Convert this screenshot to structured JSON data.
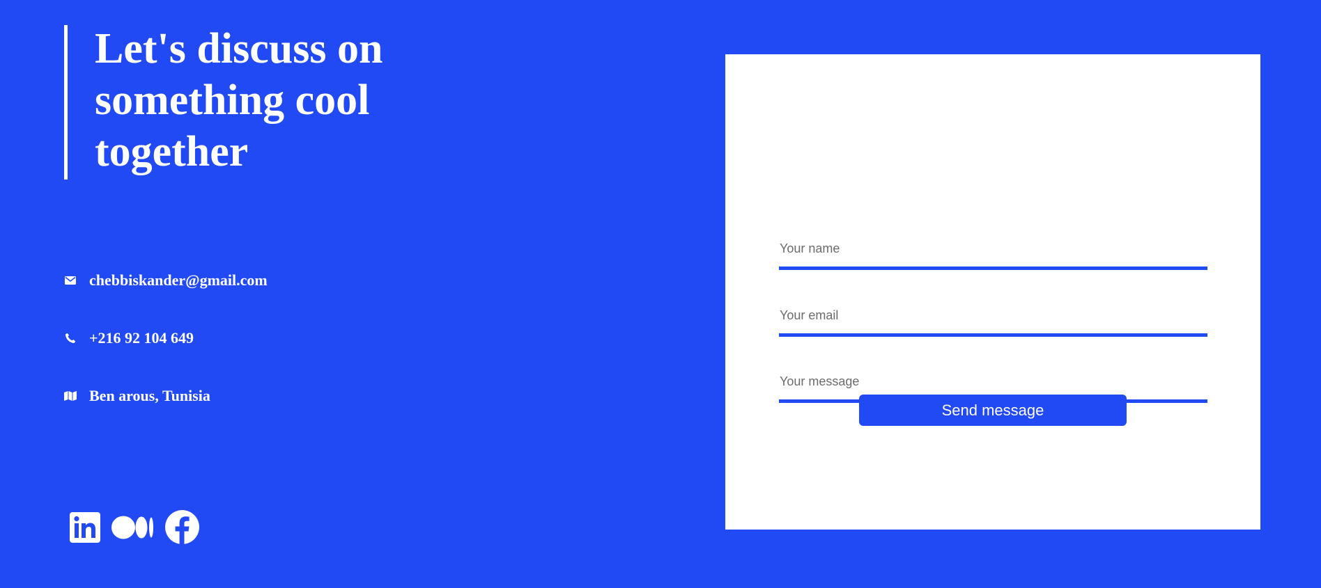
{
  "hero": {
    "heading": "Let's discuss on something cool together"
  },
  "contacts": [
    {
      "icon": "envelope-icon",
      "text": "chebbiskander@gmail.com"
    },
    {
      "icon": "phone-icon",
      "text": "+216 92 104 649"
    },
    {
      "icon": "map-icon",
      "text": "Ben arous, Tunisia"
    }
  ],
  "social": [
    {
      "icon": "linkedin-icon"
    },
    {
      "icon": "medium-icon"
    },
    {
      "icon": "facebook-icon"
    }
  ],
  "form": {
    "name_placeholder": "Your name",
    "email_placeholder": "Your email",
    "message_placeholder": "Your message",
    "submit_label": "Send message"
  },
  "colors": {
    "background": "#2149f4",
    "card": "#ffffff",
    "accent": "#2149f4",
    "text": "#ffffff"
  }
}
